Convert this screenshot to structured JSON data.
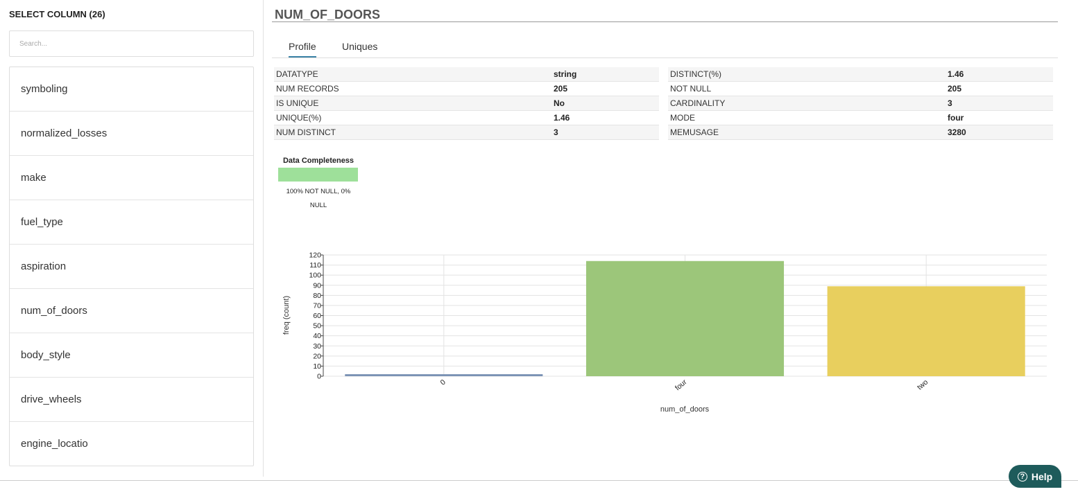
{
  "sidebar": {
    "heading": "SELECT COLUMN (26)",
    "search_placeholder": "Search...",
    "columns": [
      "symboling",
      "normalized_losses",
      "make",
      "fuel_type",
      "aspiration",
      "num_of_doors",
      "body_style",
      "drive_wheels",
      "engine_locatio"
    ]
  },
  "main": {
    "title": "NUM_OF_DOORS",
    "tabs": [
      {
        "label": "Profile",
        "active": true
      },
      {
        "label": "Uniques",
        "active": false
      }
    ],
    "stats_left": [
      {
        "key": "DATATYPE",
        "value": "string"
      },
      {
        "key": "NUM RECORDS",
        "value": "205"
      },
      {
        "key": "IS UNIQUE",
        "value": "No"
      },
      {
        "key": "UNIQUE(%)",
        "value": "1.46"
      },
      {
        "key": "NUM DISTINCT",
        "value": "3"
      }
    ],
    "stats_right": [
      {
        "key": "DISTINCT(%)",
        "value": "1.46"
      },
      {
        "key": "NOT NULL",
        "value": "205"
      },
      {
        "key": "CARDINALITY",
        "value": "3"
      },
      {
        "key": "MODE",
        "value": "four"
      },
      {
        "key": "MEMUSAGE",
        "value": "3280"
      }
    ],
    "completeness": {
      "title": "Data Completeness",
      "caption": "100% NOT NULL, 0% NULL",
      "not_null_fraction": 1.0,
      "color": "#9ee09a"
    }
  },
  "chart_data": {
    "type": "bar",
    "categories": [
      "0",
      "four",
      "two"
    ],
    "values": [
      2,
      114,
      89
    ],
    "colors": [
      "#7b93b5",
      "#9cc67a",
      "#e8cf5e"
    ],
    "xlabel": "num_of_doors",
    "ylabel": "freq (count)",
    "ylim": [
      0,
      120
    ],
    "yticks": [
      0,
      10,
      20,
      30,
      40,
      50,
      60,
      70,
      80,
      90,
      100,
      110,
      120
    ],
    "grid": true
  },
  "help": {
    "label": "Help",
    "icon": "question-circle-icon"
  }
}
